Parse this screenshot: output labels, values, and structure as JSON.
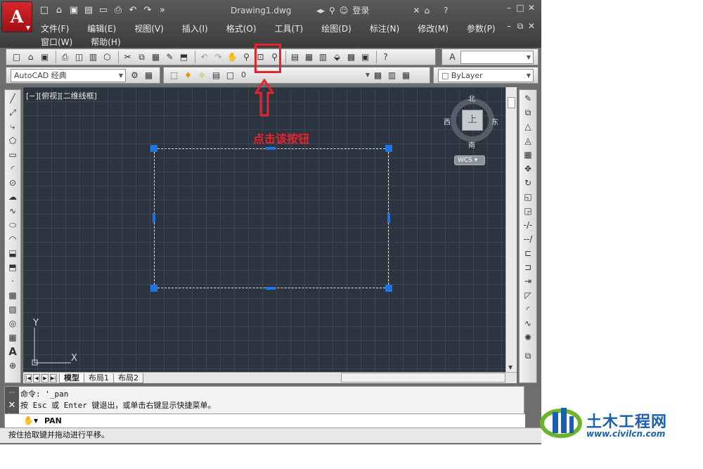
{
  "app": {
    "title": "Drawing1.dwg",
    "login": "登录",
    "logo_letter": "A",
    "accent_color": "#e8242b"
  },
  "menu_row1": [
    "文件(F)",
    "编辑(E)",
    "视图(V)",
    "插入(I)",
    "格式(O)",
    "工具(T)",
    "绘图(D)",
    "标注(N)",
    "修改(M)",
    "参数(P)"
  ],
  "menu_row2": [
    "窗口(W)",
    "帮助(H)"
  ],
  "toolbar2": {
    "workspace": "AutoCAD 经典",
    "layer": "0",
    "linetype": "ByLayer"
  },
  "viewport": {
    "label": "[−][俯视][二维线框]",
    "compass": {
      "north": "北",
      "south": "南",
      "east": "东",
      "west": "西",
      "top": "上"
    },
    "wcs": "WCS",
    "ucs_x": "X",
    "ucs_y": "Y"
  },
  "annotation": {
    "text": "点击该按钮"
  },
  "tabs": [
    "模型",
    "布局1",
    "布局2"
  ],
  "command": {
    "line1": "命令: '_pan",
    "line2": "按 Esc 或 Enter 键退出，或单击右键显示快捷菜单。",
    "input": "PAN"
  },
  "status": {
    "text": "按住拾取键并拖动进行平移。"
  },
  "watermark": {
    "title": "土木工程网",
    "url": "www.civilcn.com"
  }
}
